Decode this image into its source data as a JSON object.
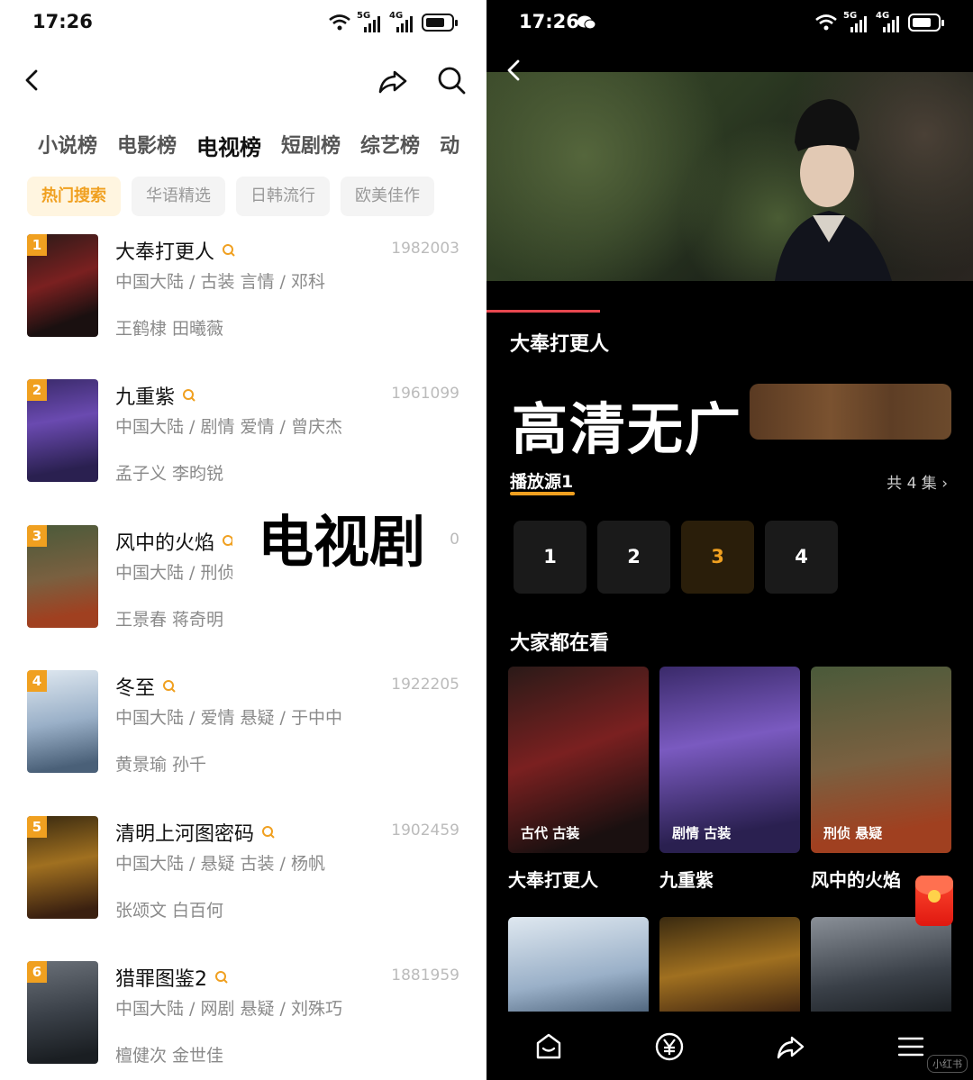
{
  "left": {
    "status": {
      "time": "17:26",
      "net1": "6",
      "net2": "5G",
      "net3": "4G"
    },
    "tabs": [
      "小说榜",
      "电影榜",
      "电视榜",
      "短剧榜",
      "综艺榜",
      "动"
    ],
    "chips": [
      "热门搜索",
      "华语精选",
      "日韩流行",
      "欧美佳作"
    ],
    "items": [
      {
        "rank": "1",
        "title": "大奉打更人",
        "meta": "中国大陆 / 古装 言情 / 邓科",
        "cast": "王鹤棣 田曦薇",
        "num": "1982003"
      },
      {
        "rank": "2",
        "title": "九重紫",
        "meta": "中国大陆 / 剧情 爱情 / 曾庆杰",
        "cast": "孟子义 李昀锐",
        "num": "1961099"
      },
      {
        "rank": "3",
        "title": "风中的火焰",
        "meta": "中国大陆 / 刑侦",
        "cast": "王景春 蒋奇明",
        "num": "0"
      },
      {
        "rank": "4",
        "title": "冬至",
        "meta": "中国大陆 / 爱情 悬疑 / 于中中",
        "cast": "黄景瑜 孙千",
        "num": "1922205"
      },
      {
        "rank": "5",
        "title": "清明上河图密码",
        "meta": "中国大陆 / 悬疑 古装 / 杨帆",
        "cast": "张颂文 白百何",
        "num": "1902459"
      },
      {
        "rank": "6",
        "title": "猎罪图鉴2",
        "meta": "中国大陆 / 网剧 悬疑 / 刘殊巧",
        "cast": "檀健次 金世佳",
        "num": "1881959"
      }
    ],
    "overlay": "电视剧",
    "colors": {
      "accent": "#f0a020"
    }
  },
  "right": {
    "status": {
      "time": "17:26",
      "net1": "6",
      "net2": "5G",
      "net3": "4G"
    },
    "show_title": "大奉打更人",
    "promo": "高清无广",
    "source": "播放源1",
    "episodes_total": "共 4 集 ›",
    "episodes": [
      "1",
      "2",
      "3",
      "4"
    ],
    "active_episode": "3",
    "section_title": "大家都在看",
    "cards": [
      {
        "name": "大奉打更人",
        "tag": "古代 古装"
      },
      {
        "name": "九重紫",
        "tag": "剧情 古装"
      },
      {
        "name": "风中的火焰",
        "tag": "刑侦 悬疑"
      }
    ],
    "watermark": "小红书",
    "nav": [
      "home-icon",
      "yuan-icon",
      "share-icon",
      "menu-icon"
    ],
    "colors": {
      "progress": "#e8474f",
      "accent": "#f0a020"
    }
  }
}
